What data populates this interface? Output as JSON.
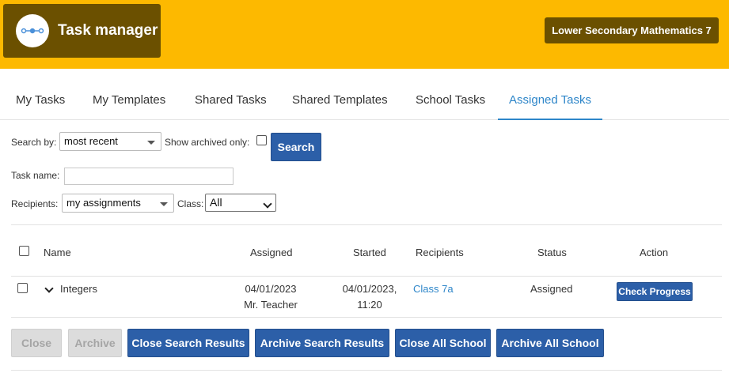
{
  "header": {
    "app_title": "Task manager",
    "course": "Lower Secondary Mathematics 7",
    "accent_color": "#FDB900",
    "brand_color": "#6B5000"
  },
  "tabs": [
    {
      "label": "My Tasks",
      "active": false
    },
    {
      "label": "My Templates",
      "active": false
    },
    {
      "label": "Shared Tasks",
      "active": false
    },
    {
      "label": "Shared Templates",
      "active": false
    },
    {
      "label": "School Tasks",
      "active": false
    },
    {
      "label": "Assigned Tasks",
      "active": true
    }
  ],
  "filters": {
    "search_by_label": "Search by:",
    "search_by_value": "most recent",
    "show_archived_label": "Show archived only:",
    "show_archived_checked": false,
    "search_button": "Search",
    "task_name_label": "Task name:",
    "task_name_value": "",
    "recipients_label": "Recipients:",
    "recipients_value": "my assignments",
    "class_label": "Class:",
    "class_value": "All"
  },
  "table": {
    "columns": {
      "name": "Name",
      "assigned": "Assigned",
      "started": "Started",
      "recipients": "Recipients",
      "status": "Status",
      "action": "Action"
    },
    "rows": [
      {
        "name": "Integers",
        "assigned_date": "04/01/2023",
        "assigned_by": "Mr. Teacher",
        "started_date": "04/01/2023,",
        "started_time": "11:20",
        "recipients": "Class 7a",
        "status": "Assigned",
        "action": "Check Progress"
      }
    ]
  },
  "footer_buttons": {
    "close": "Close",
    "archive": "Archive",
    "close_search_results": "Close Search Results",
    "archive_search_results": "Archive Search Results",
    "close_all_school": "Close All School",
    "archive_all_school": "Archive All School"
  }
}
